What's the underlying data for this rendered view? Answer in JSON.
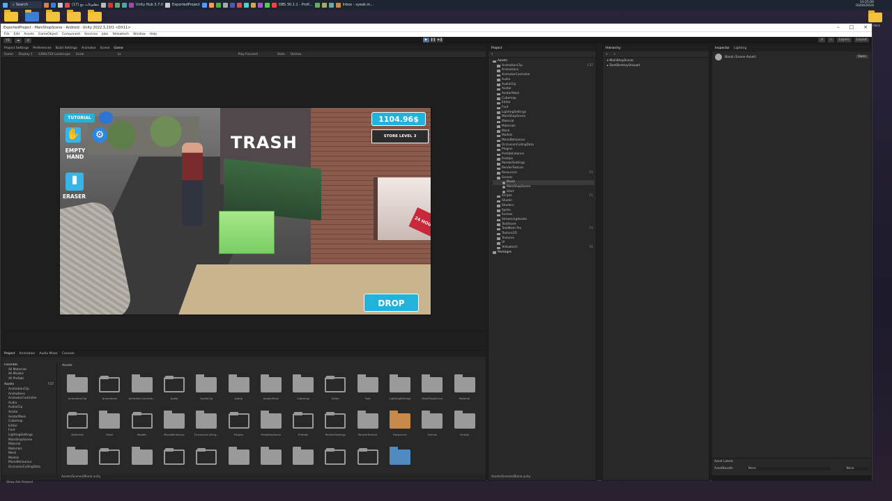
{
  "taskbar": {
    "search_label": "Search",
    "items": [
      "مطبوعات مع (17)",
      "Unity Hub 3.7.0",
      "ExportedProject",
      "OBS 30.1.1 - Profi...",
      "Inbox - syeak.m..."
    ],
    "clock_time": "14:25:00",
    "clock_date": "03/04/2024"
  },
  "desktop": {
    "right_icon_label": "Unlock"
  },
  "unity": {
    "title": "ExportedProject - MainShopScene - Android - Unity 2022.3.21f1 <DX11>",
    "menu": [
      "File",
      "Edit",
      "Assets",
      "GameObject",
      "Component",
      "Services",
      "Jobs",
      "Yellowtech",
      "Window",
      "Help"
    ],
    "toolbar_left": [
      "YB"
    ],
    "toolbar_right": [
      "Layers",
      "Layout"
    ]
  },
  "game_panel": {
    "tabs": [
      "Project Settings",
      "Preferences",
      "Build Settings",
      "Animator",
      "Scene",
      "Game"
    ],
    "sub_toolbar": [
      "Game",
      "Display 1",
      "1280x720 Landscape",
      "Scale",
      "1x",
      "Play Focused",
      "Stats",
      "Gizmos"
    ]
  },
  "hud": {
    "tutorial": "TUTORIAL",
    "empty_hand": "EMPTY HAND",
    "eraser": "ERASER",
    "title": "TRASH",
    "money": "1104.96$",
    "store_level": "STORE LEVEL 3",
    "drop": "DROP",
    "store_sign": "24 HOURS"
  },
  "project_panel": {
    "tabs": [
      "Project",
      "Animation",
      "Audio Mixer",
      "Console"
    ],
    "favorites_title": "Favorites",
    "favorites": [
      "All Materials",
      "All Models",
      "All Prefabs"
    ],
    "assets_title": "Assets",
    "left_tree": [
      "AnimationClip",
      "Animations",
      "AnimatorController",
      "Audio",
      "AudioClip",
      "Avatar",
      "AvatarMask",
      "Cubemap",
      "Editor",
      "Font",
      "LightingSettings",
      "MainShopScene",
      "Material",
      "Materials",
      "Mesh",
      "Models",
      "MonoBehaviour",
      "OcclusionCullingData"
    ],
    "breadcrumb": "Assets",
    "tiles_row1": [
      "AnimationClip",
      "Animations",
      "AnimatorControlle...",
      "Audio",
      "AudioClip",
      "Avatar",
      "AvatarMask",
      "Cubemap",
      "Editor",
      "Font",
      "LightingSettings",
      "MainShopScene",
      "Material"
    ],
    "tiles_row2": [
      "Materials",
      "Mesh",
      "Models",
      "MonoBehaviour",
      "OcclusionCulling...",
      "Plugins",
      "PrefabInstance",
      "Prefabs",
      "RenderSettings",
      "RenderTexture",
      "Resources",
      "Scenes",
      "Scripts"
    ],
    "tiles_row3": [
      "",
      "",
      "",
      "",
      "",
      "",
      "",
      "",
      "",
      "",
      ""
    ],
    "status_path": "Assets/Scenes/Blank.unity",
    "badge": "F37"
  },
  "project_tree": {
    "tab": "Project",
    "root": "Assets",
    "items": [
      {
        "label": "AnimationClip",
        "badge": "F37"
      },
      {
        "label": "Animations"
      },
      {
        "label": "AnimatorController"
      },
      {
        "label": "Audio"
      },
      {
        "label": "AudioClip"
      },
      {
        "label": "Avatar"
      },
      {
        "label": "AvatarMask"
      },
      {
        "label": "Cubemap"
      },
      {
        "label": "Editor"
      },
      {
        "label": "Font"
      },
      {
        "label": "LightingSettings"
      },
      {
        "label": "MainShopScene"
      },
      {
        "label": "Material"
      },
      {
        "label": "Materials"
      },
      {
        "label": "Mesh"
      },
      {
        "label": "Models"
      },
      {
        "label": "MonoBehaviour"
      },
      {
        "label": "OcclusionCullingData"
      },
      {
        "label": "Plugins"
      },
      {
        "label": "PrefabInstance"
      },
      {
        "label": "Prefabs"
      },
      {
        "label": "RenderSettings"
      },
      {
        "label": "RenderTexture"
      },
      {
        "label": "Resources",
        "badge": "F5"
      },
      {
        "label": "Scenes"
      },
      {
        "label": "Blank",
        "selected": true
      },
      {
        "label": "MainShopScene"
      },
      {
        "label": "Start"
      },
      {
        "label": "Scripts",
        "badge": "F1"
      },
      {
        "label": "Shader"
      },
      {
        "label": "Shaders"
      },
      {
        "label": "Sprite"
      },
      {
        "label": "Scenes"
      },
      {
        "label": "StreamingAssets"
      },
      {
        "label": "TextAsset"
      },
      {
        "label": "TextMesh Pro",
        "badge": "F5"
      },
      {
        "label": "Texture2D"
      },
      {
        "label": "Textures"
      },
      {
        "label": "UI"
      },
      {
        "label": "Yellowtech",
        "badge": "F6"
      }
    ],
    "packages": "Packages",
    "status_path": "Assets/Scenes/Blank.unity"
  },
  "hierarchy": {
    "tab": "Hierarchy",
    "items": [
      "MainShopScene",
      "DontDestroyOnLoad"
    ]
  },
  "inspector": {
    "tabs": [
      "Inspector",
      "Lighting"
    ],
    "asset_name": "Blank (Scene Asset)",
    "open_label": "Open",
    "asset_labels_title": "Asset Labels",
    "asset_bundle_label": "AssetBundle",
    "asset_bundle_value": "None",
    "asset_variant_value": "None"
  },
  "status_bar": "Show Ads Reward"
}
